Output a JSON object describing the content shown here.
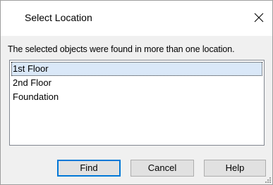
{
  "window": {
    "title": "Select Location",
    "close_icon": "close-icon"
  },
  "instruction": "The selected objects were found in more than one location.",
  "locations": [
    {
      "label": "1st Floor",
      "selected": true
    },
    {
      "label": "2nd Floor",
      "selected": false
    },
    {
      "label": "Foundation",
      "selected": false
    }
  ],
  "buttons": {
    "find": "Find",
    "cancel": "Cancel",
    "help": "Help"
  },
  "colors": {
    "default_button_border": "#0078d7",
    "selection_background": "#dae8f8"
  }
}
